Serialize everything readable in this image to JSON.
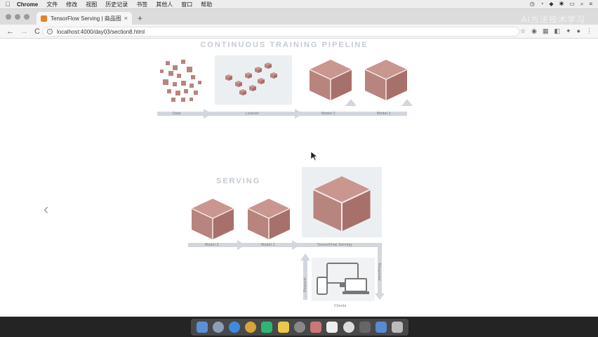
{
  "menubar": {
    "apple": "",
    "app_name": "Chrome",
    "items": [
      "文件",
      "修改",
      "视图",
      "历史记录",
      "书签",
      "其他人",
      "窗口",
      "帮助"
    ]
  },
  "browser": {
    "tab_title": "TensorFlow Serving | 商品图标",
    "tab_close": "×",
    "new_tab": "+",
    "url": "localhost:4000/day03/section8.html",
    "back": "←",
    "forward": "→",
    "reload": "C",
    "watermark": "AI方法技术学习"
  },
  "slide": {
    "pipeline_title": "CONTINUOUS TRAINING PIPELINE",
    "pipeline_labels": [
      "Data",
      "Learner",
      "Model 2",
      "Model 1"
    ],
    "serving_title": "SERVING",
    "serving_labels": [
      "Model 2",
      "Model 1",
      "TensorFlow Serving"
    ],
    "request_label": "Request",
    "response_label": "Response",
    "clients_label": "Clients",
    "prev_arrow": "‹"
  },
  "colors": {
    "cube": "#b8847e",
    "cube_dark": "#a7706a",
    "cube_light": "#c9978f",
    "arrow": "#d2d7dd"
  }
}
